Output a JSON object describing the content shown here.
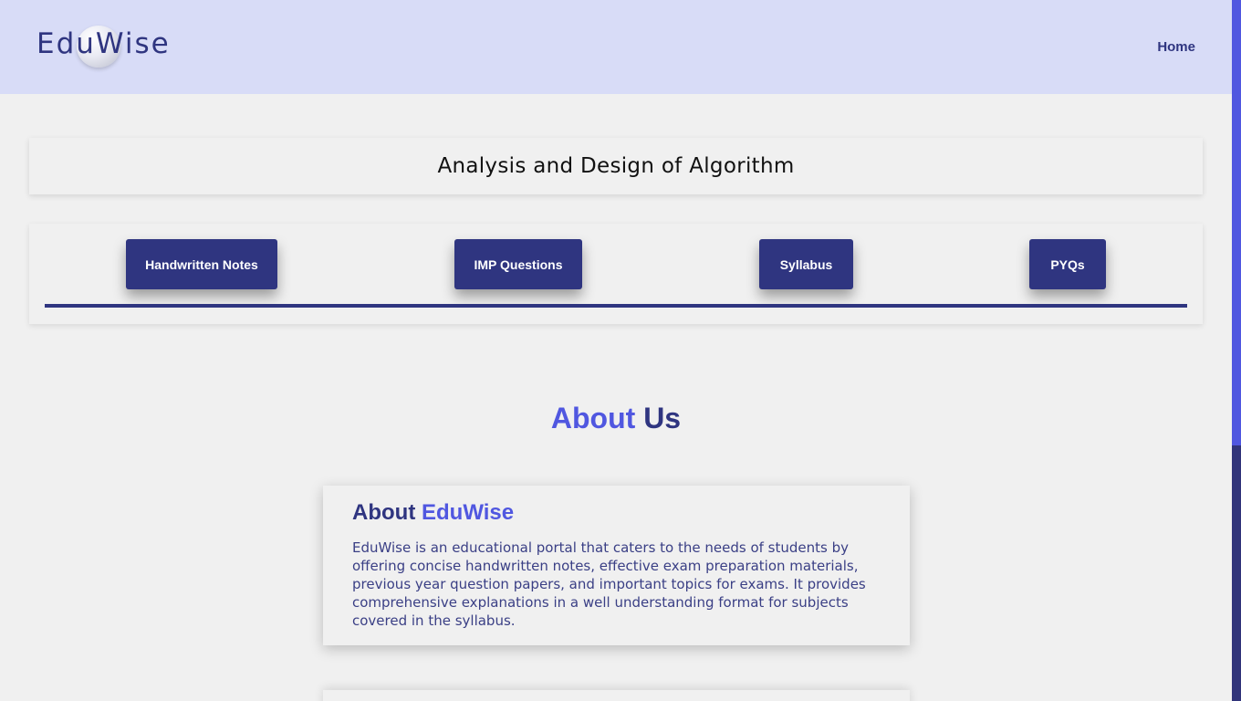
{
  "header": {
    "logo": "EduWise",
    "nav": [
      {
        "label": "Home"
      }
    ]
  },
  "subject": {
    "title": "Analysis and Design of Algorithm"
  },
  "tabs": [
    {
      "label": "Handwritten Notes"
    },
    {
      "label": "IMP Questions"
    },
    {
      "label": "Syllabus"
    },
    {
      "label": "PYQs"
    }
  ],
  "about": {
    "heading_accent": "About",
    "heading_rest": "Us",
    "card_title_prefix": "About",
    "card_title_brand": "EduWise",
    "card_text": "EduWise is an educational portal that caters to the needs of students by offering concise handwritten notes, effective exam preparation materials, previous year question papers, and important topics for exams. It provides comprehensive explanations in a well understanding format for subjects covered in the syllabus."
  },
  "colors": {
    "primary_dark": "#2f3580",
    "accent": "#5057e0",
    "header_bg": "#d8dcf7",
    "page_bg": "#f0f0f0"
  },
  "icons": {
    "logo_bubble": "glass-bubble-icon"
  }
}
